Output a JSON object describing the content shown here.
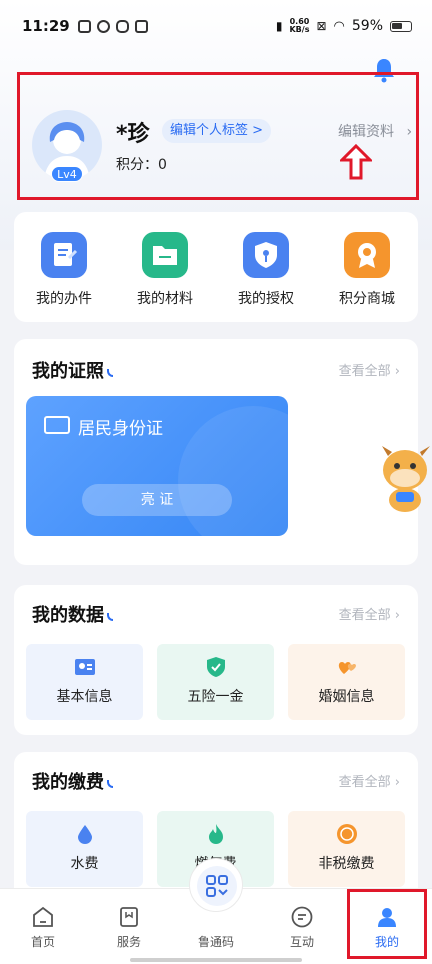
{
  "status_bar": {
    "time": "11:29",
    "speed_value": "0.60",
    "speed_unit": "KB/s",
    "battery": "59%"
  },
  "profile": {
    "username": "*珍",
    "edit_tag_label": "编辑个人标签 >",
    "points_label": "积分：0",
    "edit_profile_label": "编辑资料",
    "level": "Lv4"
  },
  "quick_actions": [
    {
      "label": "我的办件",
      "icon": "document-edit-icon",
      "color": "#4a82f0"
    },
    {
      "label": "我的材料",
      "icon": "folder-icon",
      "color": "#27b88a"
    },
    {
      "label": "我的授权",
      "icon": "shield-key-icon",
      "color": "#4a82f0"
    },
    {
      "label": "积分商城",
      "icon": "medal-icon",
      "color": "#f5952d"
    }
  ],
  "certificates": {
    "title": "我的证照",
    "see_all": "查看全部",
    "card_title": "居民身份证",
    "show_button": "亮 证"
  },
  "my_data": {
    "title": "我的数据",
    "see_all": "查看全部",
    "items": [
      {
        "label": "基本信息",
        "icon": "id-card-icon"
      },
      {
        "label": "五险一金",
        "icon": "insurance-shield-icon"
      },
      {
        "label": "婚姻信息",
        "icon": "hearts-icon"
      }
    ]
  },
  "payments": {
    "title": "我的缴费",
    "see_all": "查看全部",
    "items": [
      {
        "label": "水费",
        "icon": "water-drop-icon"
      },
      {
        "label": "燃气费",
        "icon": "flame-icon"
      },
      {
        "label": "非税缴费",
        "icon": "tax-coin-icon"
      }
    ]
  },
  "bottom_nav": {
    "home": "首页",
    "service": "服务",
    "code": "鲁通码",
    "interact": "互动",
    "mine": "我的"
  },
  "colors": {
    "accent": "#2a6bf2",
    "highlight_box": "#e0182a"
  }
}
